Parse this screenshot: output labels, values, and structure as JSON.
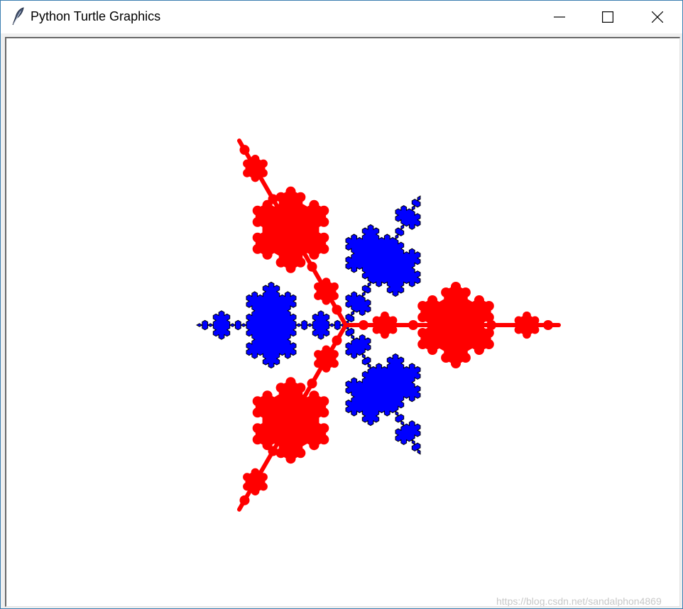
{
  "window": {
    "title": "Python Turtle Graphics",
    "icon": "feather-icon",
    "controls": [
      "minimize-icon",
      "maximize-icon",
      "close-icon"
    ]
  },
  "canvas": {
    "background": "#ffffff",
    "snowflake_fill": "#0000ff",
    "snowflake_outline": "#000000",
    "fractal_fill": "#ff0000"
  },
  "watermark": "https://blog.csdn.net/sandalphon4869"
}
